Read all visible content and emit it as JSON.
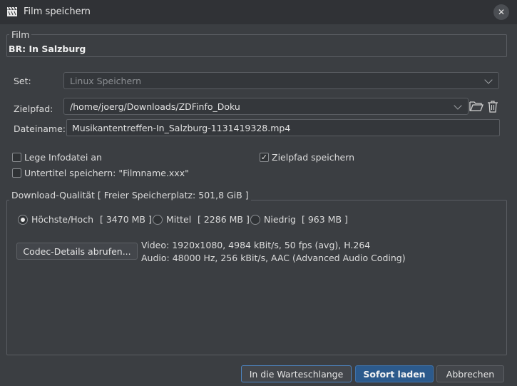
{
  "window": {
    "title": "Film speichern"
  },
  "film": {
    "legend": "Film",
    "title": "BR: In Salzburg"
  },
  "set": {
    "label": "Set:",
    "value": "Linux Speichern"
  },
  "zielpfad": {
    "label": "Zielpfad:",
    "value": "/home/joerg/Downloads/ZDFinfo_Doku"
  },
  "dateiname": {
    "label": "Dateiname:",
    "value": "Musikantentreffen-In_Salzburg-1131419328.mp4"
  },
  "options": {
    "infodatei": {
      "label": "Lege Infodatei an",
      "checked": false
    },
    "untertitel": {
      "label": "Untertitel speichern: \"Filmname.xxx\"",
      "checked": false
    },
    "zielpfad_speichern": {
      "label": "Zielpfad speichern",
      "checked": true
    }
  },
  "download": {
    "legend": "Download-Qualität [ Freier Speicherplatz: 501,8 GiB ]",
    "qualities": [
      {
        "label": "Höchste/Hoch",
        "size": "[ 3470 MB ]",
        "selected": true
      },
      {
        "label": "Mittel",
        "size": "[ 2286 MB ]",
        "selected": false
      },
      {
        "label": "Niedrig",
        "size": "[ 963 MB ]",
        "selected": false
      }
    ],
    "codec_button": "Codec-Details abrufen...",
    "video_info": "Video: 1920x1080, 4984 kBit/s, 50 fps (avg), H.264",
    "audio_info": "Audio: 48000 Hz, 256 kBit/s, AAC (Advanced Audio Coding)"
  },
  "buttons": {
    "queue": "In die Warteschlange",
    "download_now": "Sofort laden",
    "cancel": "Abbrechen"
  },
  "icons": {
    "app": "clapperboard-icon",
    "close": "close-icon",
    "folder": "folder-open-icon",
    "trash": "trash-icon"
  }
}
